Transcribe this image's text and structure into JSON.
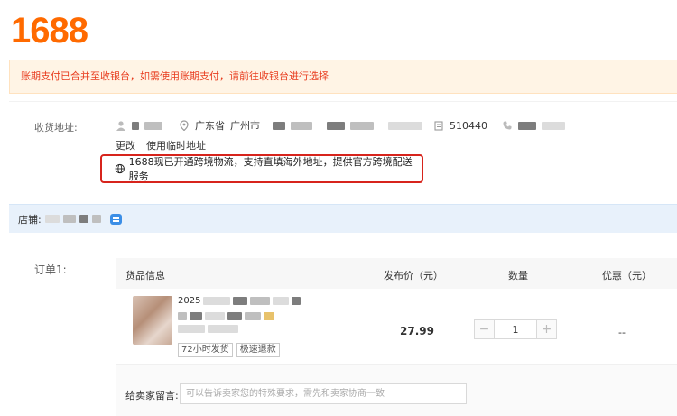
{
  "brand": {
    "logo_text": "1688",
    "color": "#ff6a00"
  },
  "notice": {
    "text": "账期支付已合并至收银台，如需使用账期支付，请前往收银台进行选择",
    "color": "#e83c1e"
  },
  "address": {
    "label": "收货地址:",
    "province": "广东省",
    "city": "广州市",
    "postal_code": "510440",
    "actions": {
      "edit": "更改",
      "temp": "使用临时地址"
    },
    "crossborder_text": "1688现已开通跨境物流，支持直填海外地址，提供官方跨境配送服务",
    "crossborder_icon": "globe-icon"
  },
  "shop": {
    "label": "店铺:",
    "chat_icon": "chat-icon"
  },
  "order": {
    "label": "订单1:",
    "headers": {
      "goods": "货品信息",
      "price": "发布价（元）",
      "quantity": "数量",
      "discount": "优惠（元）"
    },
    "item": {
      "title_prefix": "2025",
      "tags": [
        "72小时发货",
        "极速退款"
      ],
      "price": "27.99",
      "quantity": "1",
      "discount": "--"
    },
    "message": {
      "label": "给卖家留言:",
      "placeholder": "可以告诉卖家您的特殊要求，需先和卖家协商一致"
    }
  }
}
